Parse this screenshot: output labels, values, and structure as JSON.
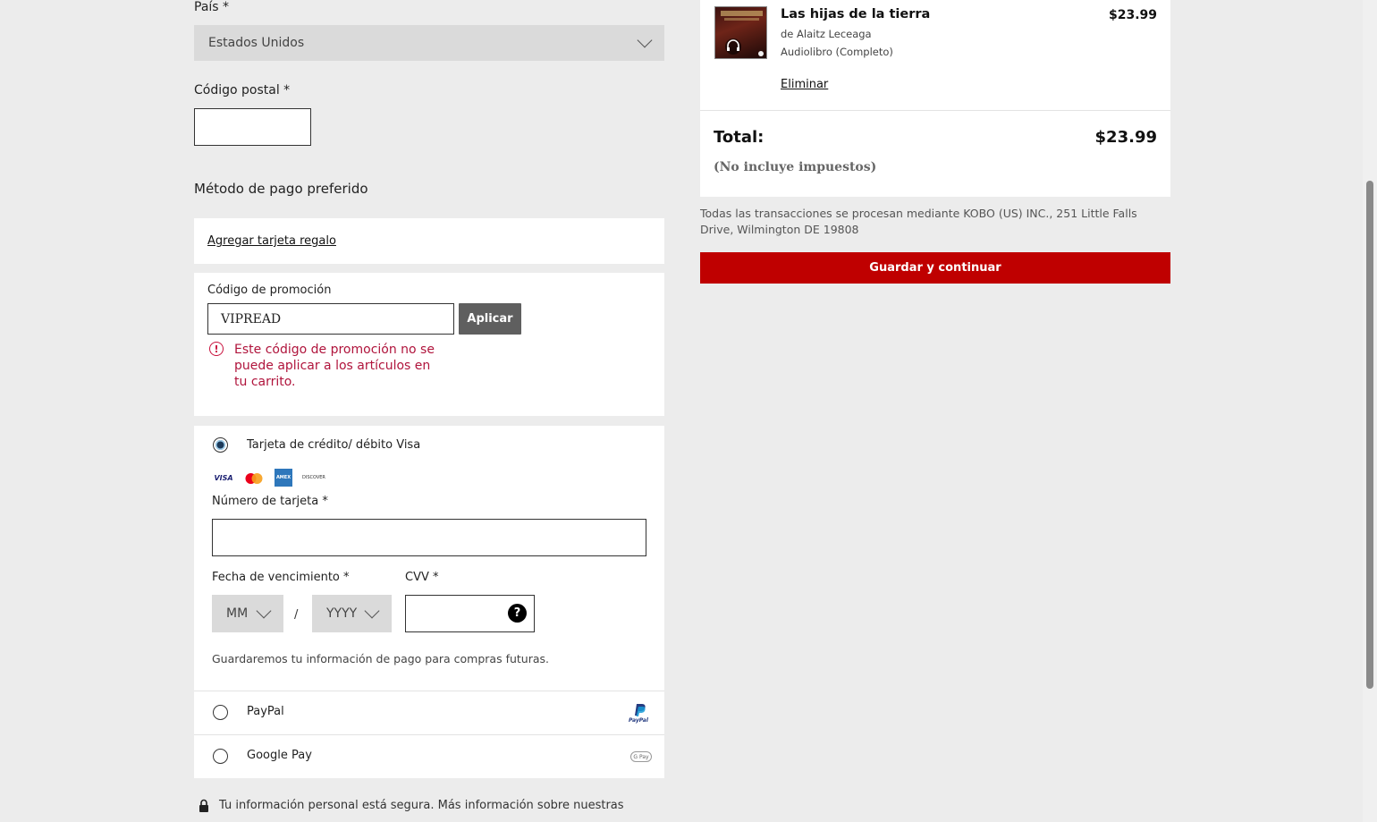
{
  "form": {
    "country_label": "País *",
    "country_value": "Estados Unidos",
    "postal_label": "Código postal *",
    "postal_value": "",
    "payment_heading": "Método de pago preferido",
    "gift_card_link": "Agregar tarjeta regalo",
    "promo": {
      "label": "Código de promoción",
      "value": "VIPREAD",
      "apply_label": "Aplicar",
      "error_lines": [
        "Este código de promoción no se",
        "puede aplicar a los artículos en",
        "tu carrito."
      ]
    },
    "card": {
      "option_label": "Tarjeta de crédito/ débito Visa",
      "selected": true,
      "brands": [
        "VISA",
        "mastercard",
        "AMEX",
        "DISCOVER"
      ],
      "number_label": "Número de tarjeta *",
      "number_value": "",
      "expiry_label": "Fecha de vencimiento *",
      "month_value": "MM",
      "year_value": "YYYY",
      "separator": "/",
      "cvv_label": "CVV *",
      "cvv_help": "?",
      "note": "Guardaremos tu información de pago para compras futuras."
    },
    "paypal": {
      "label": "PayPal",
      "logo_text": "PayPal",
      "selected": false
    },
    "gpay": {
      "label": "Google Pay",
      "logo_text": "G Pay",
      "selected": false
    },
    "privacy_line": "Tu información personal está segura. Más información sobre nuestras"
  },
  "cart": {
    "item": {
      "title": "Las hijas de la tierra",
      "author": "de Alaitz Leceaga",
      "format": "Audiolibro (Completo)",
      "price": "$23.99",
      "remove_label": "Eliminar"
    },
    "total_label": "Total:",
    "total_value": "$23.99",
    "tax_note": "(No incluye impuestos)",
    "transactions_lines": [
      "Todas las transacciones se procesan mediante KOBO (US) INC., 251 Little Falls",
      "Drive, Wilmington DE 19808"
    ],
    "save_button": "Guardar y continuar"
  },
  "colors": {
    "accent_red": "#bf0000",
    "error_red": "#b0143c",
    "page_bg": "#ececec"
  }
}
